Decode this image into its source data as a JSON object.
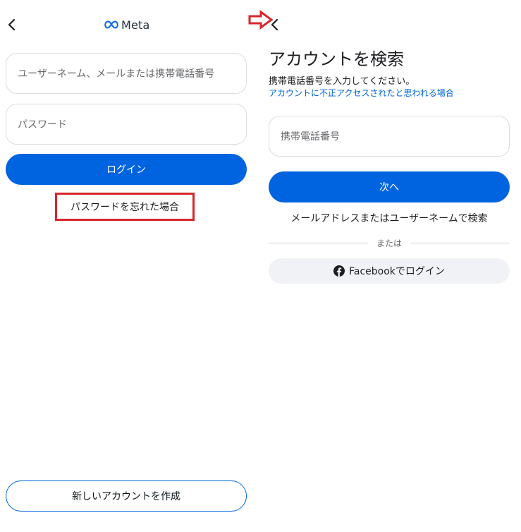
{
  "left": {
    "logo_text": "Meta",
    "username_placeholder": "ユーザーネーム、メールまたは携帯電話番号",
    "password_placeholder": "パスワード",
    "login_label": "ログイン",
    "forgot_password_label": "パスワードを忘れた場合",
    "create_account_label": "新しいアカウントを作成"
  },
  "right": {
    "title": "アカウントを検索",
    "subtitle": "携帯電話番号を入力してください。",
    "hacked_link": "アカウントに不正アクセスされたと思われる場合",
    "phone_placeholder": "携帯電話番号",
    "next_label": "次へ",
    "search_by_email_label": "メールアドレスまたはユーザーネームで検索",
    "or_label": "または",
    "facebook_login_label": "Facebookでログイン"
  },
  "annotations": {
    "arrow_color": "#d7262c",
    "highlight_color": "#d7262c"
  },
  "colors": {
    "primary": "#0064e0",
    "field_border": "#dadde1"
  }
}
